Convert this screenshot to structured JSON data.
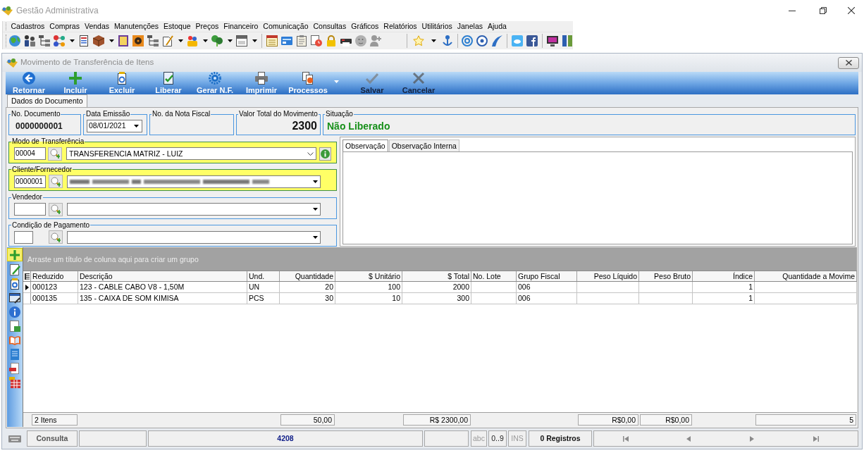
{
  "window": {
    "title": "Gestão Administrativa"
  },
  "menu": [
    "Cadastros",
    "Compras",
    "Vendas",
    "Manutenções",
    "Estoque",
    "Preços",
    "Financeiro",
    "Comunicação",
    "Consultas",
    "Gráficos",
    "Relatórios",
    "Utilitários",
    "Janelas",
    "Ajuda"
  ],
  "document_window": {
    "title": "Movimento de Transferência de Itens"
  },
  "toolbar": [
    {
      "label": "Retornar",
      "disabled": false
    },
    {
      "label": "Incluir",
      "disabled": false
    },
    {
      "label": "Excluir",
      "disabled": false
    },
    {
      "label": "Liberar",
      "disabled": false
    },
    {
      "label": "Gerar N.F.",
      "disabled": false
    },
    {
      "label": "Imprimir",
      "disabled": false
    },
    {
      "label": "Processos",
      "disabled": false,
      "has_menu": true
    },
    {
      "label": "Salvar",
      "disabled": true
    },
    {
      "label": "Cancelar",
      "disabled": true
    }
  ],
  "tabs": [
    {
      "label": "Dados do Documento",
      "selected": true
    }
  ],
  "header_fields": [
    {
      "kind": "code",
      "label": "No. Documento",
      "value": "0000000001"
    },
    {
      "kind": "date",
      "label": "Data Emissão",
      "value": "08/01/2021"
    },
    {
      "kind": "code",
      "label": "No. da Nota Fiscal"
    },
    {
      "kind": "amount",
      "label": "Valor Total do Movimento",
      "value": "2300"
    },
    {
      "kind": "status",
      "label": "Situação",
      "value": "Não Liberado"
    }
  ],
  "lookups": [
    {
      "kind": "with_info",
      "label": "Modo de Transferência",
      "code": "00004",
      "value": "TRANSFERENCIA MATRIZ - LUIZ",
      "highlighted": true
    },
    {
      "kind": "standard",
      "label": "Cliente/Fornecedor",
      "code": "0000001",
      "redacted": true,
      "highlighted": true
    },
    {
      "kind": "standard",
      "label": "Vendedor",
      "highlighted": false
    },
    {
      "kind": "compact",
      "label": "Condição de Pagamento",
      "highlighted": false
    }
  ],
  "notes": {
    "tabs": [
      {
        "label": "Observação",
        "selected": true
      },
      {
        "label": "Observação Interna",
        "selected": false
      }
    ]
  },
  "grid": {
    "add_tool": {
      "highlighted": true
    },
    "group_hint": "Arraste um título de coluna aqui para criar um grupo",
    "columns": [
      "Reduzido",
      "Descrição",
      "Und.",
      "Quantidade",
      "$ Unitário",
      "$ Total",
      "No. Lote",
      "Grupo Fiscal",
      "Peso Líquido",
      "Peso Bruto",
      "Índice",
      "Quantidade a Movime"
    ],
    "rows": [
      {
        "current": true,
        "cells": [
          "000123",
          "123 - CABLE CABO V8 - 1,50M",
          "UN",
          "20",
          "100",
          "2000",
          null,
          "006",
          null,
          null,
          "1",
          null
        ]
      },
      {
        "current": false,
        "cells": [
          "000135",
          "135 - CAIXA DE SOM KIMISA",
          "PCS",
          "30",
          "10",
          "300",
          null,
          "006",
          null,
          null,
          "1",
          null
        ]
      }
    ],
    "summaries": {
      "reduzido": "2 Itens",
      "quantidade": "50,00",
      "total": "R$ 2300,00",
      "peso_liquido": "R$0,00",
      "peso_bruto": "R$0,00",
      "quantidade_a_movime": "5"
    }
  },
  "status_bar": {
    "mode": "Consulta",
    "code": "4208",
    "indicators": [
      {
        "label": "abc",
        "enabled": false
      },
      {
        "label": "0..9",
        "enabled": true
      },
      {
        "label": "INS",
        "enabled": false
      }
    ],
    "records": "0 Registros"
  }
}
